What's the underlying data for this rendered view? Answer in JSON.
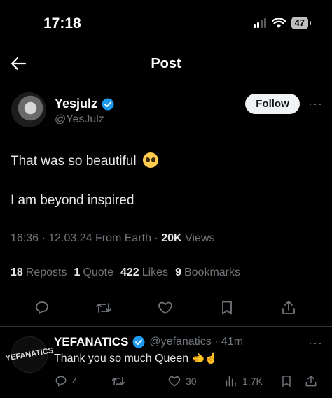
{
  "status_bar": {
    "time": "17:18",
    "battery": "47"
  },
  "header": {
    "title": "Post"
  },
  "post": {
    "author_name": "Yesjulz",
    "author_handle": "@YesJulz",
    "follow_label": "Follow",
    "more_label": "···",
    "line1": "That was so beautiful",
    "line2": "I am beyond inspired",
    "meta_prefix": "16:36 · 12.03.24 From Earth · ",
    "views_count": "20K",
    "views_label": "Views",
    "stats": {
      "reposts_count": "18",
      "reposts_label": "Reposts",
      "quotes_count": "1",
      "quotes_label": "Quote",
      "likes_count": "422",
      "likes_label": "Likes",
      "bookmarks_count": "9",
      "bookmarks_label": "Bookmarks"
    }
  },
  "reply": {
    "avatar_text": "YEFANATICS",
    "name": "YEFANATICS",
    "handle_time": "@yefanatics · 41m",
    "text": "Thank you so much Queen",
    "emoji": "🫲☝️",
    "more_label": "···",
    "replies": "4",
    "likes": "30",
    "views": "1,7K"
  },
  "colors": {
    "background": "#000000",
    "verified": "#1d9bf0",
    "muted": "#71767b",
    "divider": "#2f3336"
  },
  "icons": [
    "back-arrow-icon",
    "wifi-icon",
    "signal-icon",
    "verified-icon",
    "reply-icon",
    "repost-icon",
    "like-icon",
    "bookmark-icon",
    "share-icon",
    "views-icon"
  ]
}
